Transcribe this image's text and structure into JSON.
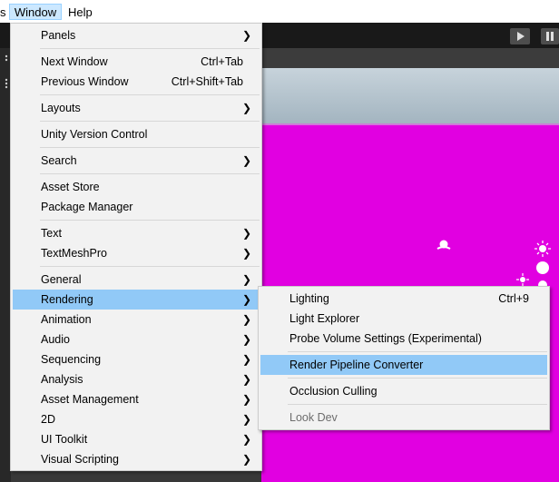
{
  "menubar": {
    "items": [
      {
        "label": "s"
      },
      {
        "label": "Window",
        "active": true
      },
      {
        "label": "Help"
      }
    ]
  },
  "window_menu": {
    "items": [
      {
        "label": "Panels",
        "submenu": true
      },
      {
        "label": "Next Window",
        "shortcut": "Ctrl+Tab"
      },
      {
        "label": "Previous Window",
        "shortcut": "Ctrl+Shift+Tab"
      },
      {
        "label": "Layouts",
        "submenu": true
      },
      {
        "label": "Unity Version Control"
      },
      {
        "label": "Search",
        "submenu": true
      },
      {
        "label": "Asset Store"
      },
      {
        "label": "Package Manager"
      },
      {
        "label": "Text",
        "submenu": true
      },
      {
        "label": "TextMeshPro",
        "submenu": true
      },
      {
        "label": "General",
        "submenu": true
      },
      {
        "label": "Rendering",
        "submenu": true,
        "highlighted": true
      },
      {
        "label": "Animation",
        "submenu": true
      },
      {
        "label": "Audio",
        "submenu": true
      },
      {
        "label": "Sequencing",
        "submenu": true
      },
      {
        "label": "Analysis",
        "submenu": true
      },
      {
        "label": "Asset Management",
        "submenu": true
      },
      {
        "label": "2D",
        "submenu": true
      },
      {
        "label": "UI Toolkit",
        "submenu": true
      },
      {
        "label": "Visual Scripting",
        "submenu": true
      }
    ]
  },
  "rendering_submenu": {
    "items": [
      {
        "label": "Lighting",
        "shortcut": "Ctrl+9"
      },
      {
        "label": "Light Explorer"
      },
      {
        "label": "Probe Volume Settings (Experimental)"
      },
      {
        "label": "Render Pipeline Converter",
        "highlighted": true
      },
      {
        "label": "Occlusion Culling"
      },
      {
        "label": "Look Dev",
        "disabled": true
      }
    ]
  },
  "toolbar": {
    "play_icon": "play-icon",
    "pause_icon": "pause-icon"
  },
  "scene": {
    "ground_color": "#e100e1",
    "sky_color": "#b8c7d1",
    "accent_highlight": "#91c9f7"
  }
}
